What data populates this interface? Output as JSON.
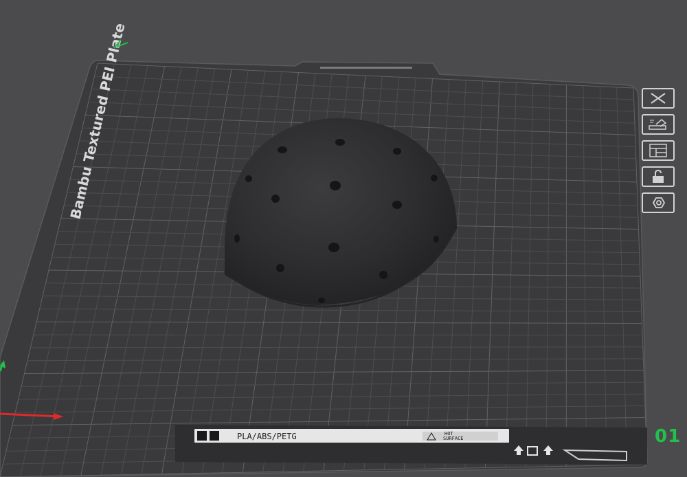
{
  "plate": {
    "name_label": "Bambu Textured PEI Plate",
    "material_label": "PLA/ABS/PETG",
    "hot_surface_line1": "HOT",
    "hot_surface_line2": "SURFACE",
    "plate_number": "01"
  },
  "toolbar": {
    "items": [
      {
        "name": "close",
        "icon": "close-icon"
      },
      {
        "name": "auto-orient",
        "icon": "auto-orient-icon"
      },
      {
        "name": "arrange",
        "icon": "arrange-icon"
      },
      {
        "name": "lock",
        "icon": "lock-icon"
      },
      {
        "name": "settings",
        "icon": "settings-icon"
      }
    ]
  },
  "model": {
    "shape": "hemisphere-dome",
    "color": "#2f2f31"
  },
  "colors": {
    "background": "#4b4b4d",
    "plate": "#3a3a3c",
    "grid": "#5c5c5e",
    "axis_x": "#e02a2a",
    "axis_y": "#23c04a",
    "plate_number": "#23c04a"
  }
}
